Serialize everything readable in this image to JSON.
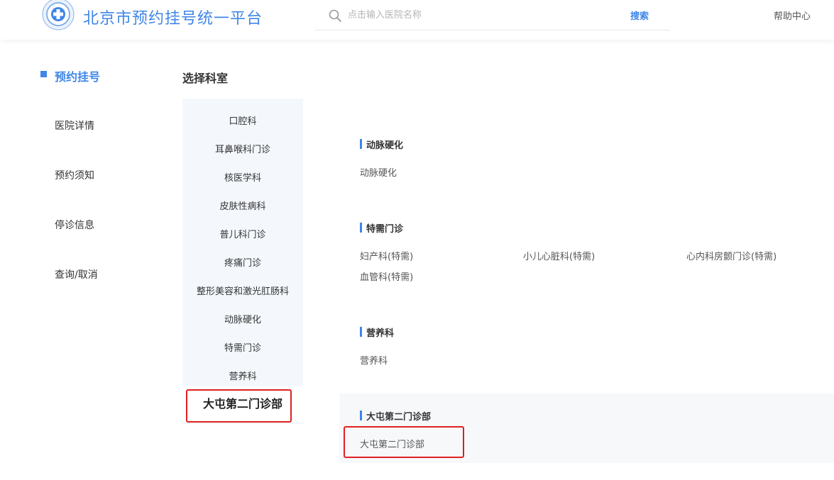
{
  "header": {
    "brand": "北京市预约挂号统一平台",
    "search_placeholder": "点击输入医院名称",
    "search_button": "搜索",
    "help": "帮助中心",
    "brand_color": "#3f86e7",
    "logo_icon": "hospital-logo-icon",
    "search_icon": "search-icon"
  },
  "left_nav": {
    "items": [
      {
        "label": "预约挂号",
        "active": true
      },
      {
        "label": "医院详情",
        "active": false
      },
      {
        "label": "预约须知",
        "active": false
      },
      {
        "label": "停诊信息",
        "active": false
      },
      {
        "label": "查询/取消",
        "active": false
      }
    ]
  },
  "section_title": "选择科室",
  "departments": [
    {
      "label": "口腔科"
    },
    {
      "label": "耳鼻喉科门诊"
    },
    {
      "label": "核医学科"
    },
    {
      "label": "皮肤性病科"
    },
    {
      "label": "普儿科门诊"
    },
    {
      "label": "疼痛门诊"
    },
    {
      "label": "整形美容和激光肛肠科"
    },
    {
      "label": "动脉硬化"
    },
    {
      "label": "特需门诊"
    },
    {
      "label": "营养科"
    },
    {
      "label": "大屯第二门诊部",
      "selected": true
    }
  ],
  "groups": [
    {
      "title": "动脉硬化",
      "items": [
        "动脉硬化"
      ]
    },
    {
      "title": "特需门诊",
      "items": [
        "妇产科(特需)",
        "小儿心脏科(特需)",
        "心内科房颤门诊(特需)",
        "血管科(特需)"
      ]
    },
    {
      "title": "营养科",
      "items": [
        "营养科"
      ]
    },
    {
      "title": "大屯第二门诊部",
      "items": [
        "大屯第二门诊部"
      ],
      "highlighted": true
    }
  ],
  "colors": {
    "accent": "#3f86e7",
    "highlight": "#e02020",
    "list_background": "#f4f8fd"
  }
}
